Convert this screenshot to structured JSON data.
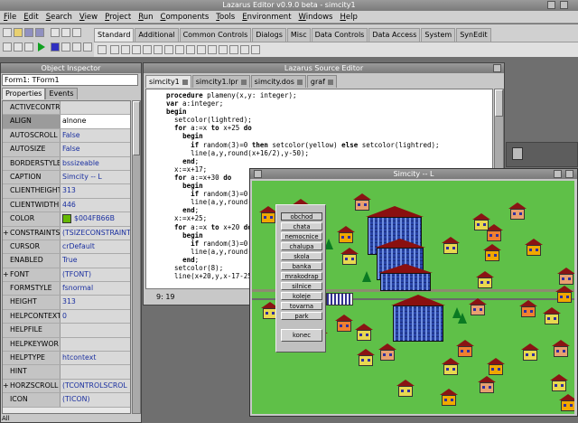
{
  "main_window": {
    "title": "Lazarus Editor v0.9.0 beta - simcity1"
  },
  "menu": [
    "File",
    "Edit",
    "Search",
    "View",
    "Project",
    "Run",
    "Components",
    "Tools",
    "Environment",
    "Windows",
    "Help"
  ],
  "palette_tabs": [
    "Standard",
    "Additional",
    "Common Controls",
    "Dialogs",
    "Misc",
    "Data Controls",
    "Data Access",
    "System",
    "SynEdit"
  ],
  "object_inspector": {
    "title": "Object Inspector",
    "component": "Form1: TForm1",
    "tabs": [
      "Properties",
      "Events"
    ],
    "rows": [
      {
        "name": "ACTIVECONTR",
        "value": ""
      },
      {
        "name": "ALIGN",
        "value": "alnone"
      },
      {
        "name": "AUTOSCROLL",
        "value": "False"
      },
      {
        "name": "AUTOSIZE",
        "value": "False"
      },
      {
        "name": "BORDERSTYLE",
        "value": "bssizeable"
      },
      {
        "name": "CAPTION",
        "value": "Simcity -- L"
      },
      {
        "name": "CLIENTHEIGHT",
        "value": "313"
      },
      {
        "name": "CLIENTWIDTH",
        "value": "446"
      },
      {
        "name": "COLOR",
        "value": "$004FB66B"
      },
      {
        "name": "CONSTRAINTS",
        "value": "(TSIZECONSTRAINT"
      },
      {
        "name": "CURSOR",
        "value": "crDefault"
      },
      {
        "name": "ENABLED",
        "value": "True"
      },
      {
        "name": "FONT",
        "value": "(TFONT)"
      },
      {
        "name": "FORMSTYLE",
        "value": "fsnormal"
      },
      {
        "name": "HEIGHT",
        "value": "313"
      },
      {
        "name": "HELPCONTEXT",
        "value": "0"
      },
      {
        "name": "HELPFILE",
        "value": ""
      },
      {
        "name": "HELPKEYWOR",
        "value": ""
      },
      {
        "name": "HELPTYPE",
        "value": "htcontext"
      },
      {
        "name": "HINT",
        "value": ""
      },
      {
        "name": "HORZSCROLL",
        "value": "(TCONTROLSCROL"
      },
      {
        "name": "ICON",
        "value": "(TICON)"
      }
    ],
    "status": "All"
  },
  "source_editor": {
    "title": "Lazarus Source Editor",
    "tabs": [
      "simcity1",
      "simcity1.lpr",
      "simcity.dos",
      "graf"
    ],
    "cursor_pos": "9: 19"
  },
  "simcity": {
    "title": "Simcity -- L",
    "menu_buttons": [
      "obchod",
      "chata",
      "nemocnice",
      "chalupa",
      "skola",
      "banka",
      "mrakodrap",
      "silnice",
      "koleje",
      "tovarna",
      "park"
    ],
    "quit_label": "konec"
  },
  "colors": {
    "canvas_green": "#5fc048",
    "form_color": "#66B804"
  }
}
